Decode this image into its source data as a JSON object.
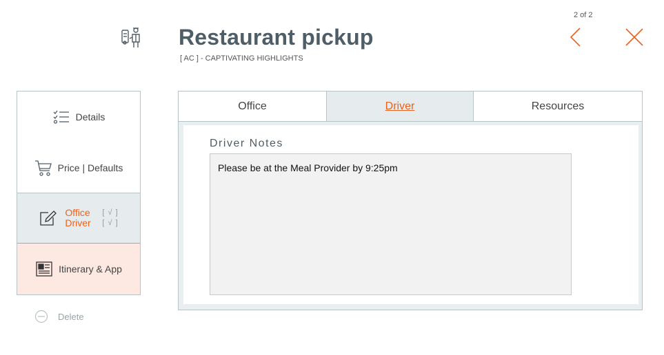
{
  "header": {
    "title": "Restaurant pickup",
    "subtitle": "[ AC ] - CAPTIVATING HIGHLIGHTS",
    "page_counter": "2 of 2",
    "icon": "driver-icon"
  },
  "sidebar": {
    "items": [
      {
        "label": "Details",
        "icon": "checklist-icon"
      },
      {
        "label": "Price | Defaults",
        "icon": "cart-icon"
      },
      {
        "label_office": "Office",
        "label_driver": "Driver",
        "check": "[ √ ]",
        "icon": "edit-icon"
      },
      {
        "label": "Itinerary & App",
        "icon": "newspaper-icon"
      }
    ],
    "delete_label": "Delete"
  },
  "tabs": [
    {
      "label": "Office"
    },
    {
      "label": "Driver",
      "active": true
    },
    {
      "label": "Resources"
    }
  ],
  "driver_notes": {
    "label": "Driver Notes",
    "value": "Please be at the Meal Provider by 9:25pm"
  },
  "colors": {
    "accent": "#e8621f",
    "title": "#4f5d66",
    "border": "#b7c4c7",
    "active_bg": "#e6eced",
    "highlight_bg": "#fde9e1"
  }
}
